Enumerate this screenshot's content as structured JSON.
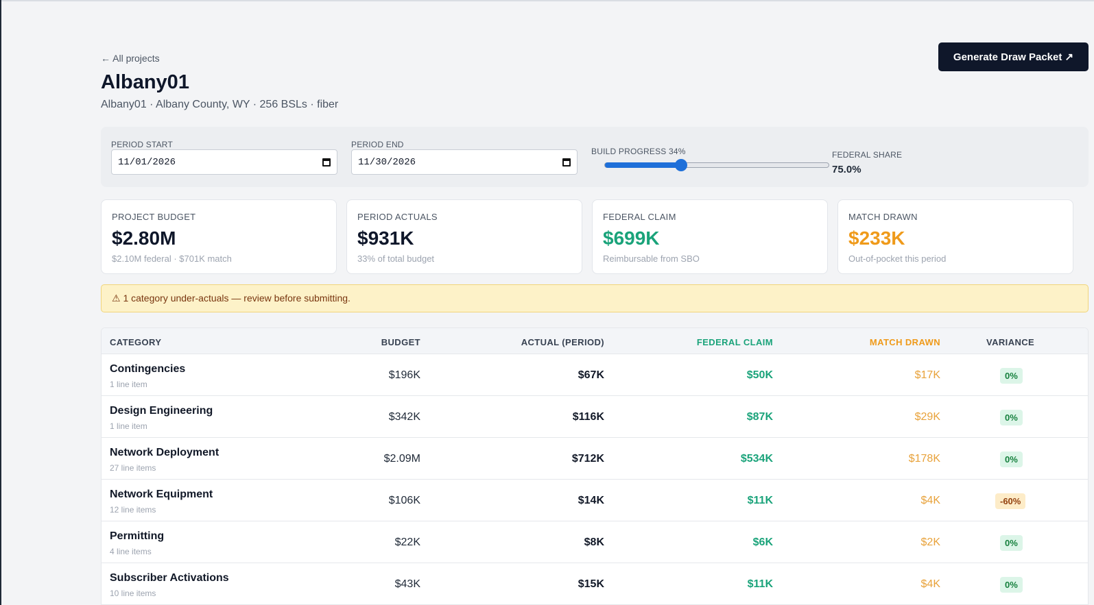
{
  "nav": {
    "back_label": "← All projects"
  },
  "header": {
    "title": "Albany01",
    "subtitle": "Albany01 · Albany County, WY · 256 BSLs · fiber",
    "generate_label": "Generate Draw Packet ↗"
  },
  "controls": {
    "period_start_label": "PERIOD START",
    "period_start_value": "11/01/2026",
    "period_end_label": "PERIOD END",
    "period_end_value": "11/30/2026",
    "build_progress_label": "BUILD PROGRESS 34%",
    "build_progress_value": 0.34,
    "federal_share_label": "FEDERAL SHARE",
    "federal_share_value": "75.0%"
  },
  "stats": [
    {
      "label": "PROJECT BUDGET",
      "value": "$2.80M",
      "sub": "$2.10M federal · $701K match",
      "color": "#0f172a"
    },
    {
      "label": "PERIOD ACTUALS",
      "value": "$931K",
      "sub": "33% of total budget",
      "color": "#0f172a"
    },
    {
      "label": "FEDERAL CLAIM",
      "value": "$699K",
      "sub": "Reimbursable from SBO",
      "color": "#1aa37a"
    },
    {
      "label": "MATCH DRAWN",
      "value": "$233K",
      "sub": "Out-of-pocket this period",
      "color": "#ef9a1a"
    }
  ],
  "warning": {
    "icon": "warning-icon",
    "text": "⚠ 1 category under-actuals — review before submitting."
  },
  "table": {
    "headers": {
      "category": "CATEGORY",
      "budget": "BUDGET",
      "actual": "ACTUAL (PERIOD)",
      "federal": "FEDERAL CLAIM",
      "match": "MATCH DRAWN",
      "variance": "VARIANCE"
    },
    "header_colors": {
      "federal": "#1aa37a",
      "match": "#ef9a1a"
    },
    "rows": [
      {
        "name": "Contingencies",
        "items": "1 line item",
        "budget": "$196K",
        "actual": "$67K",
        "federal": "$50K",
        "match": "$17K",
        "variance": "0%",
        "status": "ok"
      },
      {
        "name": "Design Engineering",
        "items": "1 line item",
        "budget": "$342K",
        "actual": "$116K",
        "federal": "$87K",
        "match": "$29K",
        "variance": "0%",
        "status": "ok"
      },
      {
        "name": "Network Deployment",
        "items": "27 line items",
        "budget": "$2.09M",
        "actual": "$712K",
        "federal": "$534K",
        "match": "$178K",
        "variance": "0%",
        "status": "ok"
      },
      {
        "name": "Network Equipment",
        "items": "12 line items",
        "budget": "$106K",
        "actual": "$14K",
        "federal": "$11K",
        "match": "$4K",
        "variance": "-60%",
        "status": "warn"
      },
      {
        "name": "Permitting",
        "items": "4 line items",
        "budget": "$22K",
        "actual": "$8K",
        "federal": "$6K",
        "match": "$2K",
        "variance": "0%",
        "status": "ok"
      },
      {
        "name": "Subscriber Activations",
        "items": "10 line items",
        "budget": "$43K",
        "actual": "$15K",
        "federal": "$11K",
        "match": "$4K",
        "variance": "0%",
        "status": "ok"
      }
    ]
  }
}
